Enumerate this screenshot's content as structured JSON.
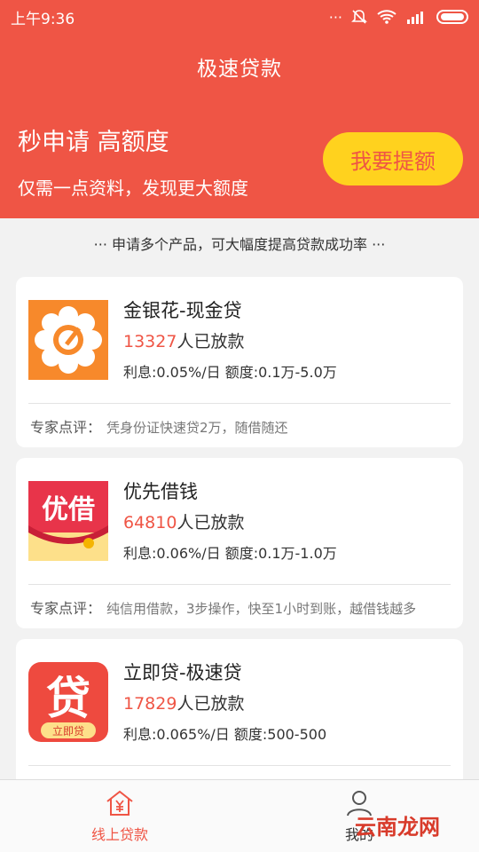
{
  "status_bar": {
    "time": "上午9:36",
    "dots": "···"
  },
  "header": {
    "title": "极速贷款"
  },
  "hero": {
    "title": "秒申请 高额度",
    "subtitle": "仅需一点资料，发现更大额度",
    "button": "我要提额"
  },
  "notice": "··· 申请多个产品，可大幅度提高贷款成功率 ···",
  "review_label": "专家点评：",
  "count_suffix": "人已放款",
  "products": [
    {
      "name": "金银花-现金贷",
      "count": "13327",
      "rate": "利息:0.05%/日   额度:0.1万-5.0万",
      "review": "凭身份证快速贷2万，随借随还"
    },
    {
      "name": "优先借钱",
      "count": "64810",
      "rate": "利息:0.06%/日   额度:0.1万-1.0万",
      "review": "纯信用借款，3步操作，快至1小时到账，越借钱越多"
    },
    {
      "name": "立即贷-极速贷",
      "count": "17829",
      "rate": "利息:0.065%/日   额度:500-500",
      "review": ""
    }
  ],
  "logos": {
    "youjie_text": "优借",
    "lijidai_char": "贷",
    "lijidai_text": "立即贷"
  },
  "tabs": [
    {
      "label": "线上贷款",
      "icon": "yen-house-icon"
    },
    {
      "label": "我的",
      "icon": "user-icon"
    }
  ],
  "watermark": "云南龙网",
  "colors": {
    "primary": "#ef5545",
    "accent": "#ffd21e"
  }
}
